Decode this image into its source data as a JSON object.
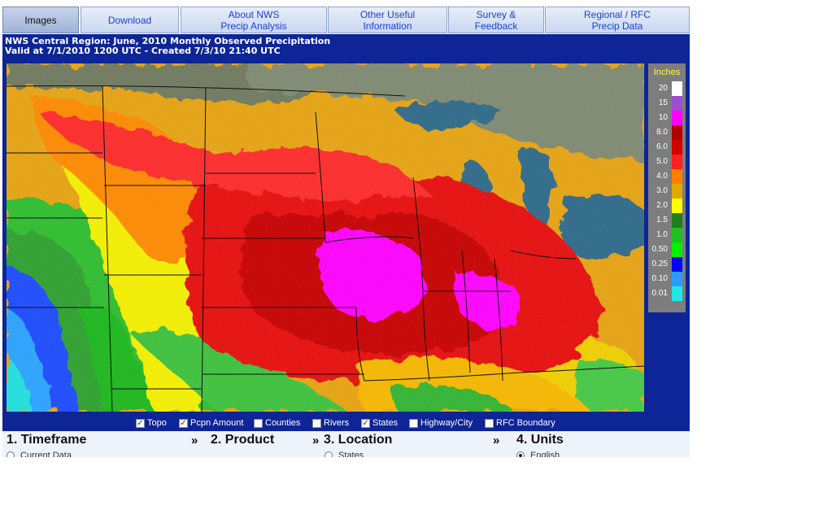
{
  "tabs": [
    {
      "label": "Images",
      "active": true
    },
    {
      "label": "Download"
    },
    {
      "label": "About NWS\nPrecip Analysis"
    },
    {
      "label": "Other Useful\nInformation"
    },
    {
      "label": "Survey &\nFeedback"
    },
    {
      "label": "Regional / RFC\nPrecip Data"
    }
  ],
  "header": {
    "line1": "NWS Central Region: June, 2010 Monthly Observed Precipitation",
    "line2": "Valid at 7/1/2010 1200 UTC - Created 7/3/10 21:40 UTC"
  },
  "legend": {
    "title": "Inches",
    "items": [
      {
        "label": "20",
        "color": "#ffffff"
      },
      {
        "label": "15",
        "color": "#9b4fd0"
      },
      {
        "label": "10",
        "color": "#ff00ff"
      },
      {
        "label": "8.0",
        "color": "#b00000"
      },
      {
        "label": "6.0",
        "color": "#d40000"
      },
      {
        "label": "5.0",
        "color": "#ff2020"
      },
      {
        "label": "4.0",
        "color": "#ff8000"
      },
      {
        "label": "3.0",
        "color": "#e0a800"
      },
      {
        "label": "2.0",
        "color": "#ffff00"
      },
      {
        "label": "1.5",
        "color": "#1e7e1e"
      },
      {
        "label": "1.0",
        "color": "#20c020"
      },
      {
        "label": "0.50",
        "color": "#00f000"
      },
      {
        "label": "0.25",
        "color": "#0000ff"
      },
      {
        "label": "0.10",
        "color": "#2a9bff"
      },
      {
        "label": "0.01",
        "color": "#20e6e6"
      }
    ]
  },
  "layers": [
    {
      "label": "Topo",
      "checked": true
    },
    {
      "label": "Pcpn Amount",
      "checked": true
    },
    {
      "label": "Counties",
      "checked": false
    },
    {
      "label": "Rivers",
      "checked": false
    },
    {
      "label": "States",
      "checked": true
    },
    {
      "label": "Highway/City",
      "checked": false
    },
    {
      "label": "RFC Boundary",
      "checked": false
    }
  ],
  "steps": {
    "timeframe": "1. Timeframe",
    "product": "2. Product",
    "location": "3. Location",
    "units": "4. Units",
    "arrow": "»"
  },
  "radios": {
    "timeframe": "Current Data",
    "location": "States",
    "units": "English"
  }
}
